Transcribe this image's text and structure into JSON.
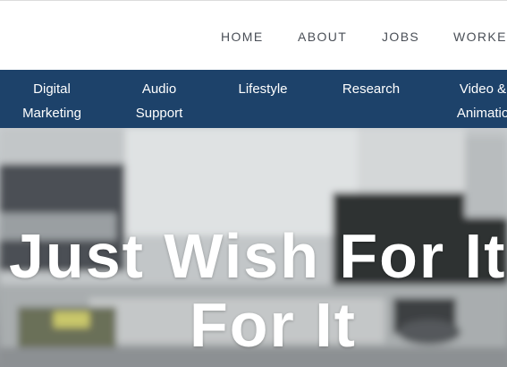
{
  "top_nav": {
    "items": [
      {
        "label": "HOME"
      },
      {
        "label": "ABOUT"
      },
      {
        "label": "JOBS"
      },
      {
        "label": "WORKE"
      }
    ]
  },
  "category_bar": {
    "background": "#1d426a",
    "items": [
      {
        "line1": "Digital",
        "line2": "Marketing"
      },
      {
        "line1": "Audio",
        "line2": "Support"
      },
      {
        "line1": "Lifestyle",
        "line2": ""
      },
      {
        "line1": "Research",
        "line2": ""
      },
      {
        "line1": "Video &",
        "line2": "Animatio"
      }
    ]
  },
  "hero": {
    "headline_line1": "Just Wish For It",
    "headline_line2": "For It"
  }
}
